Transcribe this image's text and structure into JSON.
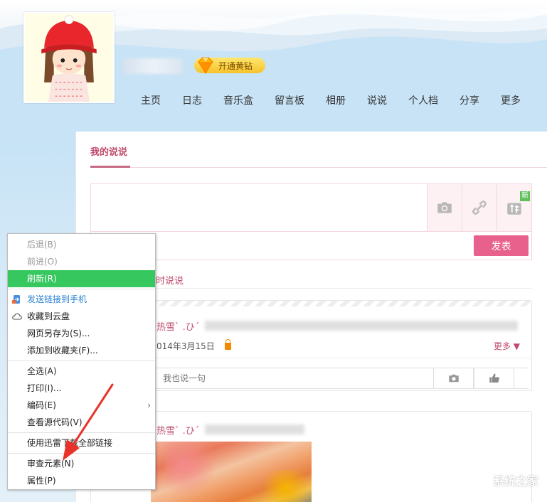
{
  "header": {
    "vip_label": "开通黄钻"
  },
  "nav": {
    "items": [
      "主页",
      "日志",
      "音乐盒",
      "留言板",
      "相册",
      "说说",
      "个人档",
      "分享",
      "更多"
    ]
  },
  "panel": {
    "tab_label": "我的说说",
    "new_badge": "新",
    "publish_label": "发表",
    "feed_tab_label": "时说说"
  },
  "feed": {
    "post1": {
      "author": "热雪ˋ .ひˊ",
      "date": "014年3月15日",
      "more_label": "更多 ▼",
      "reply_placeholder": "我也说一句"
    },
    "post2": {
      "author": "热雪ˋ .ひˊ"
    }
  },
  "context_menu": {
    "items": [
      {
        "label": "后退(B)",
        "state": "disabled"
      },
      {
        "label": "前进(O)",
        "state": "disabled"
      },
      {
        "label": "刷新(R)",
        "state": "active"
      },
      {
        "label": "发送链接到手机",
        "state": "blue"
      },
      {
        "label": "收藏到云盘",
        "state": "normal"
      },
      {
        "label": "网页另存为(S)...",
        "state": "normal"
      },
      {
        "label": "添加到收藏夹(F)...",
        "state": "normal"
      },
      {
        "label": "全选(A)",
        "state": "normal"
      },
      {
        "label": "打印(I)...",
        "state": "normal"
      },
      {
        "label": "编码(E)",
        "state": "normal"
      },
      {
        "label": "查看源代码(V)",
        "state": "normal"
      },
      {
        "label": "使用迅雷下载全部链接",
        "state": "normal"
      },
      {
        "label": "审查元素(N)",
        "state": "normal"
      },
      {
        "label": "属性(P)",
        "state": "normal"
      }
    ]
  },
  "watermark": {
    "text": "系统之家"
  },
  "colors": {
    "accent_pink": "#e8618c",
    "tab_red": "#c04a6b",
    "menu_active": "#37c75f",
    "link_blue": "#2a7fd0",
    "arrow_red": "#e8332a"
  }
}
